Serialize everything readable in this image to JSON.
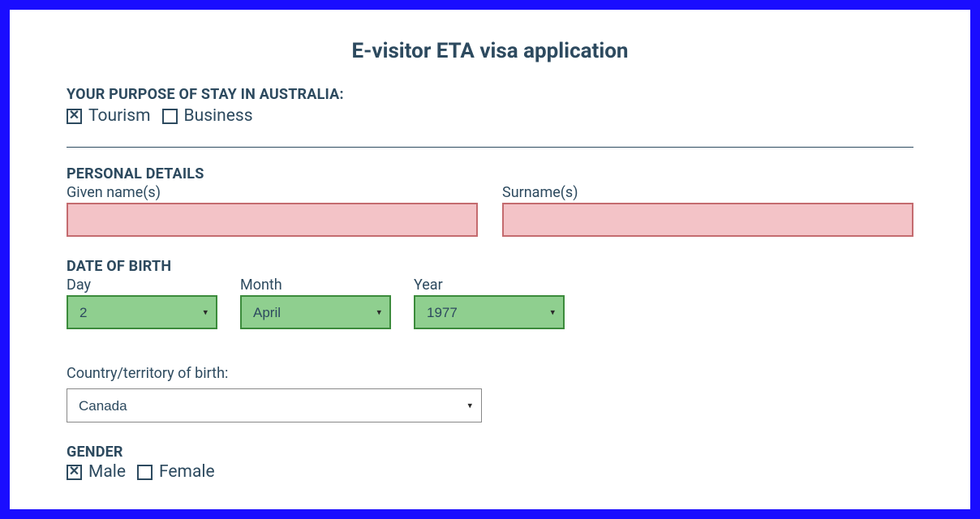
{
  "title": "E-visitor ETA visa application",
  "purpose": {
    "heading": "YOUR PURPOSE OF STAY IN AUSTRALIA:",
    "tourism_label": "Tourism",
    "business_label": "Business",
    "tourism_checked": true,
    "business_checked": false
  },
  "personal": {
    "heading": "PERSONAL DETAILS",
    "given_label": "Given name(s)",
    "surname_label": "Surname(s)",
    "given_value": "",
    "surname_value": ""
  },
  "dob": {
    "heading": "DATE OF BIRTH",
    "day_label": "Day",
    "month_label": "Month",
    "year_label": "Year",
    "day_value": "2",
    "month_value": "April",
    "year_value": "1977"
  },
  "country": {
    "label": "Country/territory of birth:",
    "value": "Canada"
  },
  "gender": {
    "heading": "GENDER",
    "male_label": "Male",
    "female_label": "Female",
    "male_checked": true,
    "female_checked": false
  }
}
